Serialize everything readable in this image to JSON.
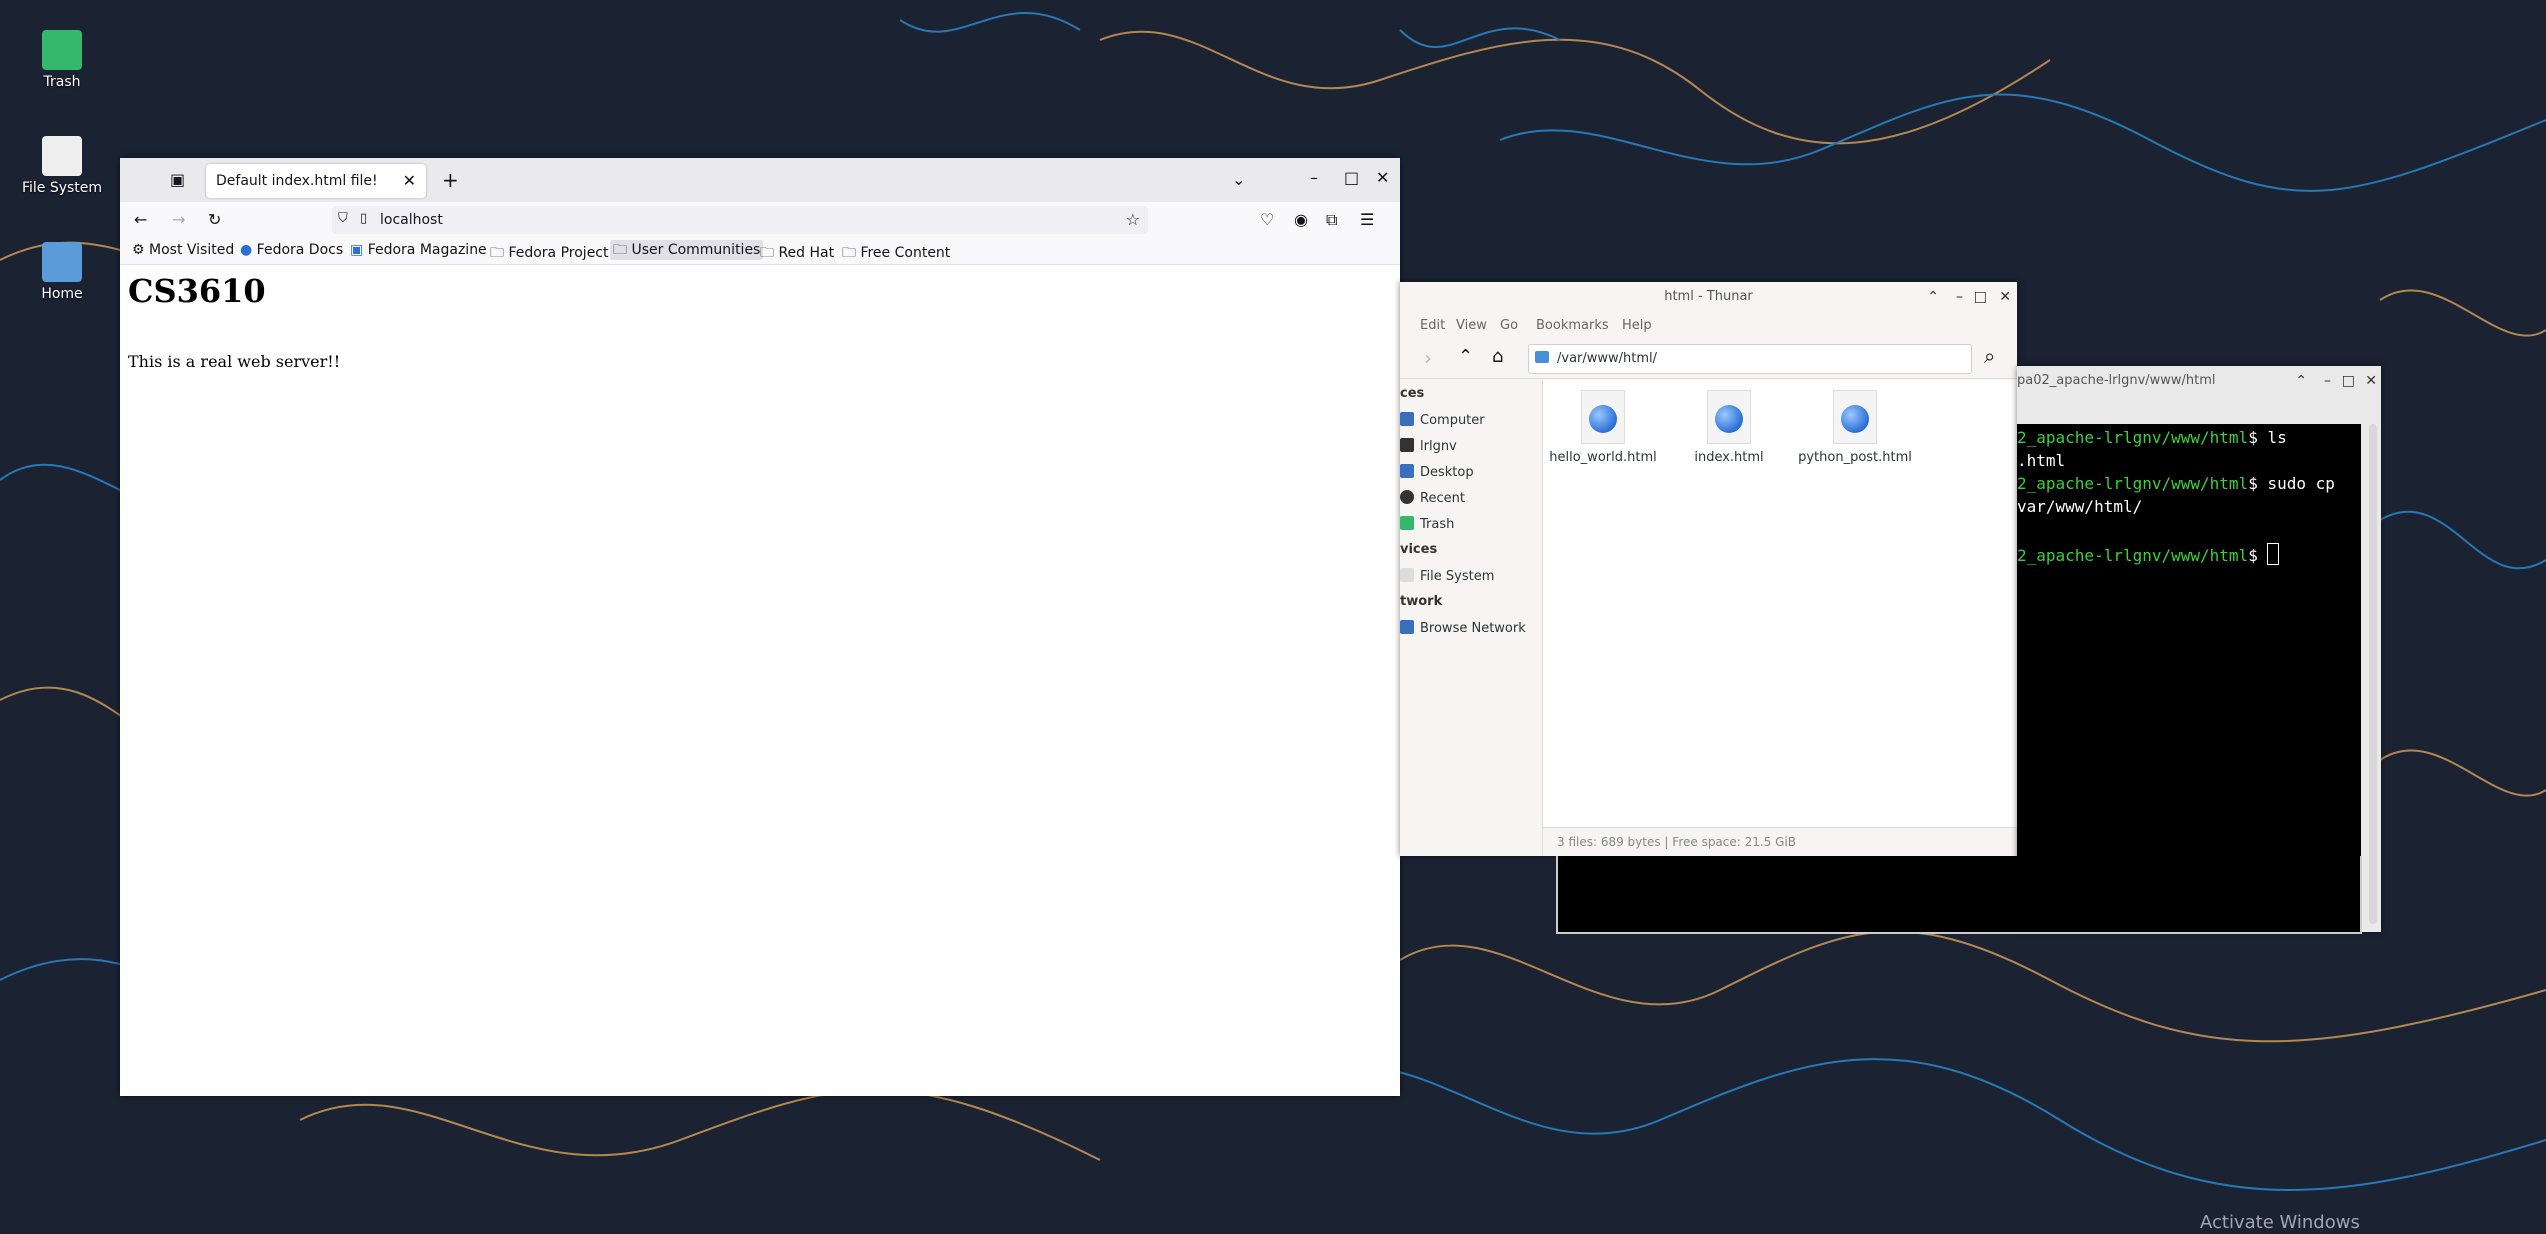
{
  "desktop": {
    "icons": [
      {
        "label": "Trash"
      },
      {
        "label": "File System"
      },
      {
        "label": "Home"
      }
    ],
    "watermark": "Activate Windows"
  },
  "firefox": {
    "tab_title": "Default index.html file!",
    "url": "localhost",
    "bookmarks": [
      "Most Visited",
      "Fedora Docs",
      "Fedora Magazine",
      "Fedora Project",
      "User Communities",
      "Red Hat",
      "Free Content"
    ],
    "page_heading": "CS3610",
    "page_text": "This is a real web server!!"
  },
  "thunar": {
    "title": "html - Thunar",
    "menu": [
      "Edit",
      "View",
      "Go",
      "Bookmarks",
      "Help"
    ],
    "location": "/var/www/html/",
    "sidebar": {
      "places_header": "ces",
      "places": [
        "Computer",
        "lrlgnv",
        "Desktop",
        "Recent",
        "Trash"
      ],
      "devices_header": "vices",
      "devices": [
        "File System"
      ],
      "network_header": "twork",
      "network": [
        "Browse Network"
      ]
    },
    "files": [
      "hello_world.html",
      "index.html",
      "python_post.html"
    ],
    "status": "3 files: 689 bytes  |  Free space: 21.5 GiB"
  },
  "terminal": {
    "title": "pa02_apache-lrlgnv/www/html",
    "lines": [
      {
        "prompt": "2_apache-lrlgnv/www/html",
        "text": "$ ls"
      },
      {
        "prompt": "",
        "text": ".html"
      },
      {
        "prompt": "2_apache-lrlgnv/www/html",
        "text": "$ sudo cp"
      },
      {
        "prompt": "",
        "text": "var/www/html/"
      },
      {
        "prompt": "",
        "text": ""
      },
      {
        "prompt": "2_apache-lrlgnv/www/html",
        "text": "$ "
      }
    ]
  },
  "colors": {
    "wallpaper": "#1b2232",
    "terminal_green": "#3ad13a"
  }
}
